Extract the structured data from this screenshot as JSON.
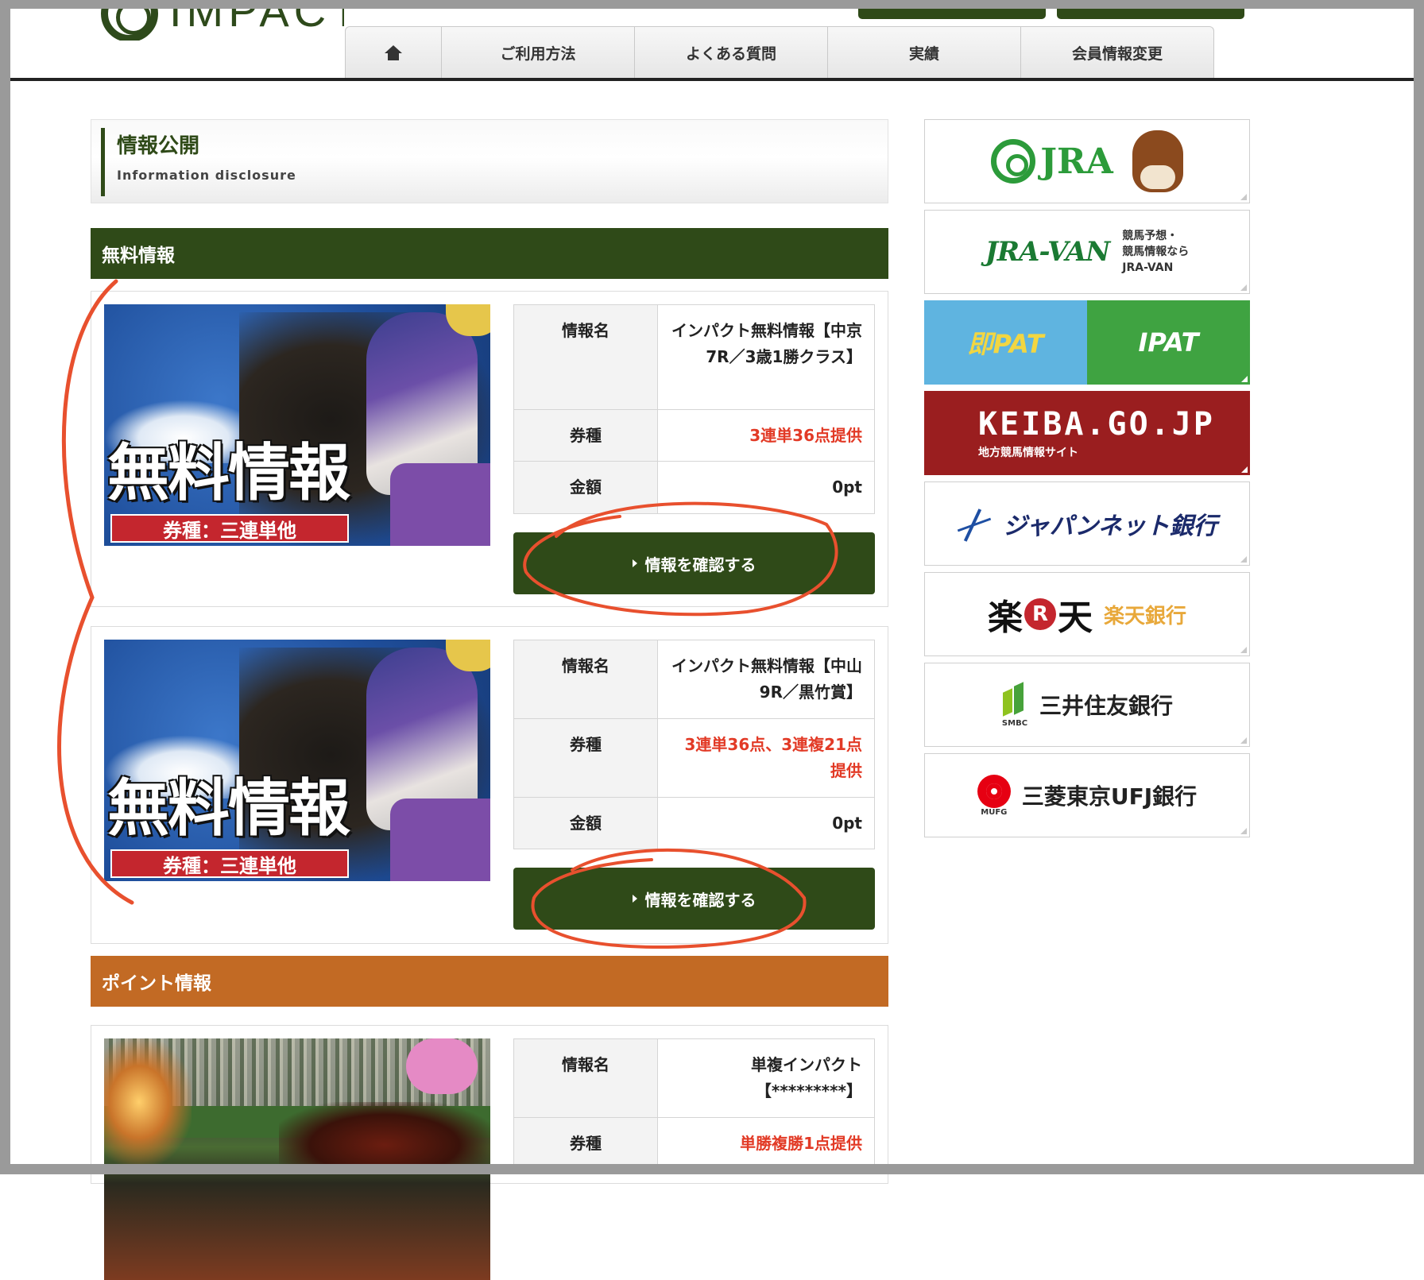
{
  "header": {
    "logo_text": "IMPACT",
    "nav": [
      {
        "label": ""
      },
      {
        "label": "ご利用方法"
      },
      {
        "label": "よくある質問"
      },
      {
        "label": "実績"
      },
      {
        "label": "会員情報変更"
      }
    ]
  },
  "page_title": {
    "title": "情報公開",
    "subtitle": "Information disclosure"
  },
  "sections": {
    "free": "無料情報",
    "point": "ポイント情報"
  },
  "thumb": {
    "big_text": "無料情報",
    "tag_text": "券種：三連単他"
  },
  "labels": {
    "name": "情報名",
    "ticket": "券種",
    "price": "金額"
  },
  "cards": [
    {
      "name": "インパクト無料情報【中京7R／3歳1勝クラス】",
      "ticket": "3連単36点提供",
      "price": "0pt",
      "cta": "情報を確認する"
    },
    {
      "name": "インパクト無料情報【中山9R／黒竹賞】",
      "ticket": "3連単36点、3連複21点提供",
      "price": "0pt",
      "cta": "情報を確認する"
    },
    {
      "name": "単複インパクト【*********】",
      "ticket": "単勝複勝1点提供"
    }
  ],
  "sidebar": {
    "jra": "JRA",
    "jravan_logo": "JRA-VAN",
    "jravan_note_1": "競馬予想・",
    "jravan_note_2": "競馬情報なら",
    "jravan_note_3": "JRA-VAN",
    "sokupat": "即PAT",
    "ipat": "IPAT",
    "keiba": "KEIBA.GO.JP",
    "keiba_sub": "地方競馬情報サイト",
    "japannet": "ジャパンネット銀行",
    "rakuten_left": "楽",
    "rakuten_r": "R",
    "rakuten_right": "天",
    "rakuten_bank": "楽天銀行",
    "smbc_label": "SMBC",
    "smbc": "三井住友銀行",
    "mufg_label": "MUFG",
    "mufg": "三菱東京UFJ銀行"
  },
  "colors": {
    "brand_green": "#2f4a18",
    "point_orange": "#c26a24",
    "accent_red": "#e23a26",
    "annotation_red": "#e8502e"
  }
}
